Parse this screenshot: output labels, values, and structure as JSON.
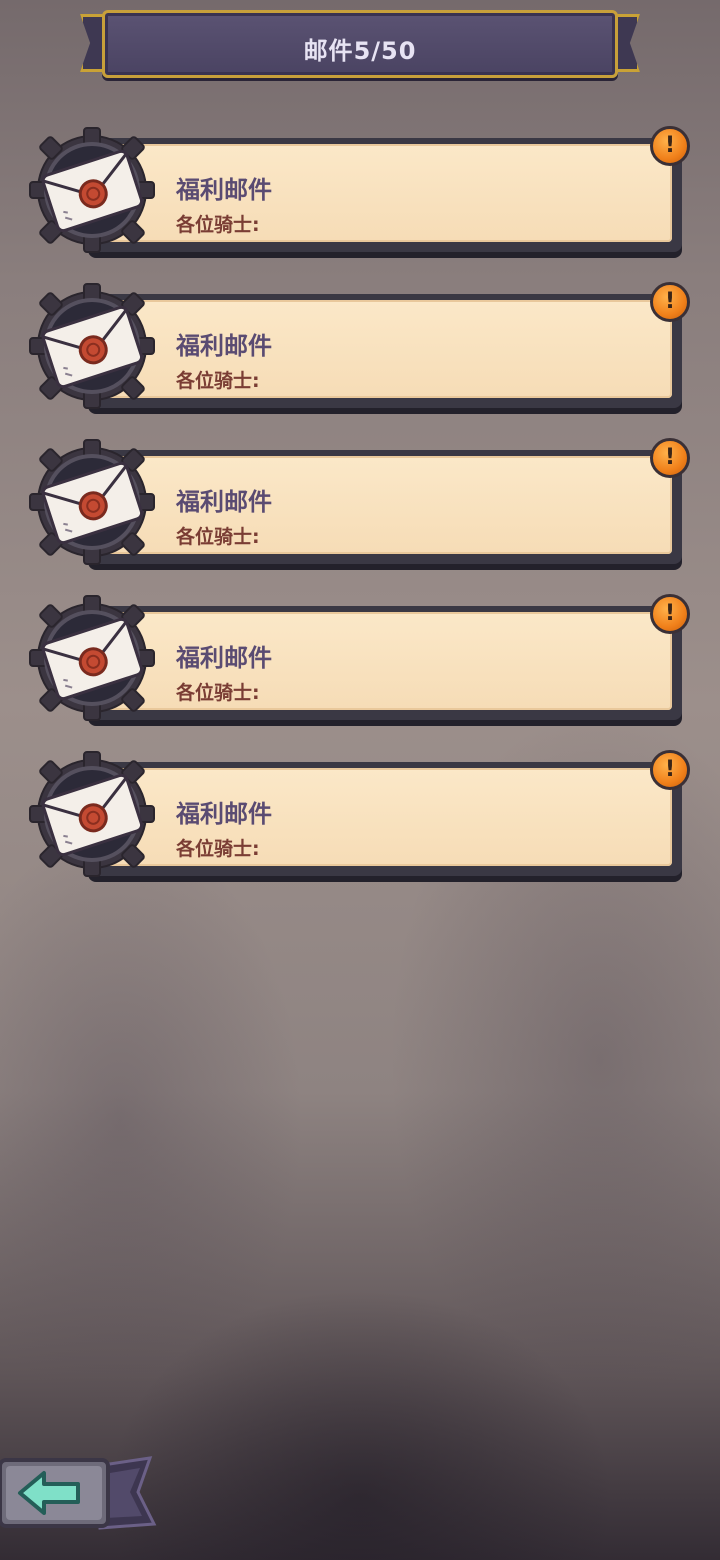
{
  "header": {
    "title": "邮件",
    "count": "5/50"
  },
  "mails": [
    {
      "title": "福利邮件",
      "greeting": "各位骑士:",
      "unread": true
    },
    {
      "title": "福利邮件",
      "greeting": "各位骑士:",
      "unread": true
    },
    {
      "title": "福利邮件",
      "greeting": "各位骑士:",
      "unread": true
    },
    {
      "title": "福利邮件",
      "greeting": "各位骑士:",
      "unread": true
    },
    {
      "title": "福利邮件",
      "greeting": "各位骑士:",
      "unread": true
    }
  ],
  "icons": {
    "mail": "envelope-icon",
    "alert": "exclamation-icon",
    "back": "back-arrow-icon"
  },
  "alert_symbol": "!",
  "colors": {
    "title_plate": "#4a4362",
    "gold_trim": "#c8a03a",
    "paper": "#f6dcb6",
    "mail_title": "#5a4b72",
    "greeting": "#7a3d34",
    "alert": "#f0801a",
    "back_arrow": "#7fe0c8"
  }
}
